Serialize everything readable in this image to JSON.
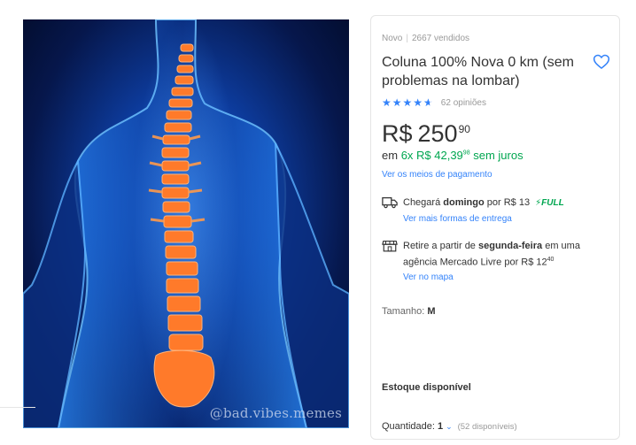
{
  "image": {
    "watermark": "@bad.vibes.memes",
    "alt": "spine-illustration"
  },
  "product": {
    "condition": "Novo",
    "sold": "2667 vendidos",
    "title": "Coluna 100% Nova 0 km (sem problemas na lombar)",
    "rating": {
      "stars": 4.5,
      "reviews": "62 opiniões"
    },
    "price": {
      "currency": "R$",
      "integer": "250",
      "cents": "90"
    },
    "installments": {
      "prefix": "em",
      "plan": "6x R$ 42,39",
      "plan_cents": "98",
      "suffix": "sem juros"
    },
    "payment_link": "Ver os meios de pagamento"
  },
  "shipping": {
    "arrival_prefix": "Chegará",
    "arrival_day": "domingo",
    "arrival_price": "por R$ 13",
    "badge": "FULL",
    "more_link": "Ver mais formas de entrega"
  },
  "pickup": {
    "text_prefix": "Retire a partir de",
    "text_day": "segunda-feira",
    "text_suffix": "em uma agência Mercado Livre por R$ 12",
    "text_cents": "40",
    "map_link": "Ver no mapa"
  },
  "size": {
    "label": "Tamanho:",
    "value": "M"
  },
  "stock": "Estoque disponível",
  "quantity": {
    "label": "Quantidade:",
    "value": "1",
    "available": "(52 disponíveis)"
  },
  "colors": {
    "accent": "#3483fa",
    "green": "#00a650"
  },
  "icons": [
    "heart-icon",
    "star-icon",
    "truck-icon",
    "lightning-icon",
    "store-icon",
    "chevron-down-icon"
  ]
}
